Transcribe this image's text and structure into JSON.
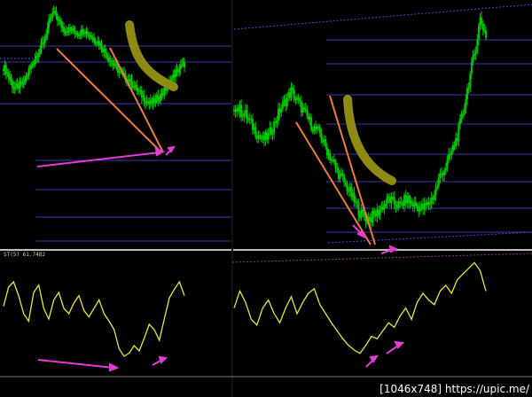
{
  "indicator_label": "ST(5) 61.7482",
  "watermark": "[1046x748] https://upic.me/",
  "colors": {
    "background": "#000000",
    "candle": "#00c800",
    "level_line": "#3a3aa8",
    "trend_line": "#3f3fc2",
    "arrow_orange": "#f07a3c",
    "arrow_magenta": "#e53bd6",
    "curve_olive": "#8f8a14",
    "oscillator": "#e8e830",
    "separator": "#bdbdbd"
  },
  "chart_data": [
    {
      "type": "candlestick-with-oscillator",
      "pane": "left",
      "price_relative": [
        0.62,
        0.55,
        0.47,
        0.48,
        0.5,
        0.58,
        0.65,
        0.72,
        0.78,
        0.9,
        0.98,
        0.92,
        0.86,
        0.86,
        0.85,
        0.84,
        0.86,
        0.83,
        0.8,
        0.77,
        0.72,
        0.67,
        0.62,
        0.58,
        0.55,
        0.52,
        0.48,
        0.44,
        0.4,
        0.36,
        0.38,
        0.41,
        0.45,
        0.5,
        0.56,
        0.6,
        0.63
      ],
      "oscillator": [
        62,
        80,
        85,
        72,
        55,
        48,
        75,
        82,
        60,
        50,
        68,
        75,
        60,
        55,
        65,
        72,
        58,
        52,
        60,
        68,
        55,
        48,
        40,
        22,
        15,
        18,
        25,
        20,
        32,
        45,
        40,
        30,
        50,
        70,
        78,
        85,
        72
      ],
      "oscillator_ylim": [
        0,
        100
      ]
    },
    {
      "type": "candlestick-with-oscillator",
      "pane": "right",
      "price_relative": [
        0.58,
        0.56,
        0.54,
        0.5,
        0.46,
        0.43,
        0.45,
        0.5,
        0.56,
        0.6,
        0.64,
        0.6,
        0.56,
        0.52,
        0.48,
        0.46,
        0.4,
        0.35,
        0.3,
        0.26,
        0.22,
        0.17,
        0.12,
        0.1,
        0.1,
        0.12,
        0.15,
        0.18,
        0.16,
        0.15,
        0.18,
        0.16,
        0.15,
        0.14,
        0.16,
        0.2,
        0.28,
        0.32,
        0.38,
        0.45,
        0.55,
        0.68,
        0.8,
        0.95,
        0.88
      ],
      "oscillator": [
        55,
        70,
        60,
        45,
        40,
        55,
        62,
        50,
        42,
        55,
        65,
        50,
        60,
        68,
        72,
        58,
        50,
        42,
        35,
        28,
        22,
        18,
        15,
        22,
        30,
        28,
        35,
        42,
        38,
        48,
        55,
        45,
        60,
        68,
        62,
        58,
        70,
        75,
        68,
        80,
        85,
        90,
        95,
        88,
        70
      ],
      "oscillator_ylim": [
        0,
        100
      ]
    }
  ]
}
